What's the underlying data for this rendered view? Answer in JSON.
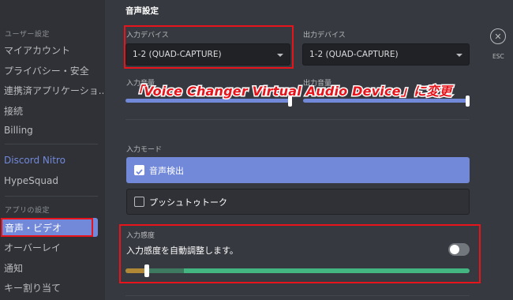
{
  "sidebar": {
    "user_settings_header": "ユーザー設定",
    "items_top": [
      "マイアカウント",
      "プライバシー・安全",
      "連携済アプリケーショ...",
      "接続",
      "Billing"
    ],
    "nitro": "Discord Nitro",
    "hypesquad": "HypeSquad",
    "app_settings_header": "アプリの設定",
    "selected": "音声・ビデオ",
    "items_bottom": [
      "オーバーレイ",
      "通知",
      "キー割り当て"
    ]
  },
  "main": {
    "section_title": "音声設定",
    "input_device_label": "入力デバイス",
    "input_device_value": "1-2 (QUAD-CAPTURE)",
    "output_device_label": "出力デバイス",
    "output_device_value": "1-2 (QUAD-CAPTURE)",
    "input_volume_label": "入力音量",
    "output_volume_label": "出力音量",
    "input_mode_label": "入力モード",
    "mode_voice_activity": "音声検出",
    "mode_push_to_talk": "プッシュトゥトーク",
    "sensitivity_label": "入力感度",
    "auto_sensitivity_text": "入力感度を自動調整します。",
    "auto_sensitivity_on": false,
    "esc_label": "ESC"
  },
  "annotation": {
    "text": "「Voice Changer Virtual Audio Device」に変更",
    "color": "#e8141b"
  }
}
